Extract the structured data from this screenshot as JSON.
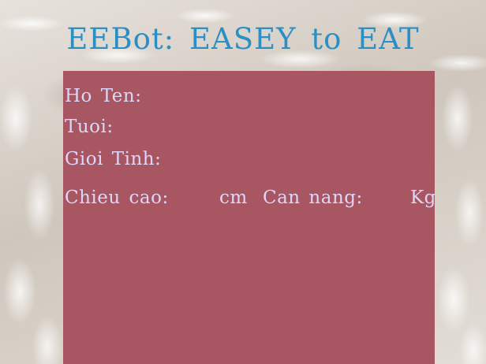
{
  "header": {
    "title": "EEBot: EASEY to EAT"
  },
  "form": {
    "name_label": "Ho Ten:",
    "age_label": "Tuoi:",
    "gender_label": "Gioi Tinh:",
    "height_label": "Chieu cao:",
    "height_unit": "cm",
    "weight_label": "Can nang:",
    "weight_unit": "Kg"
  },
  "colors": {
    "title": "#2c8fc4",
    "panel": "#a85762",
    "label_text": "#dcd7f8"
  }
}
